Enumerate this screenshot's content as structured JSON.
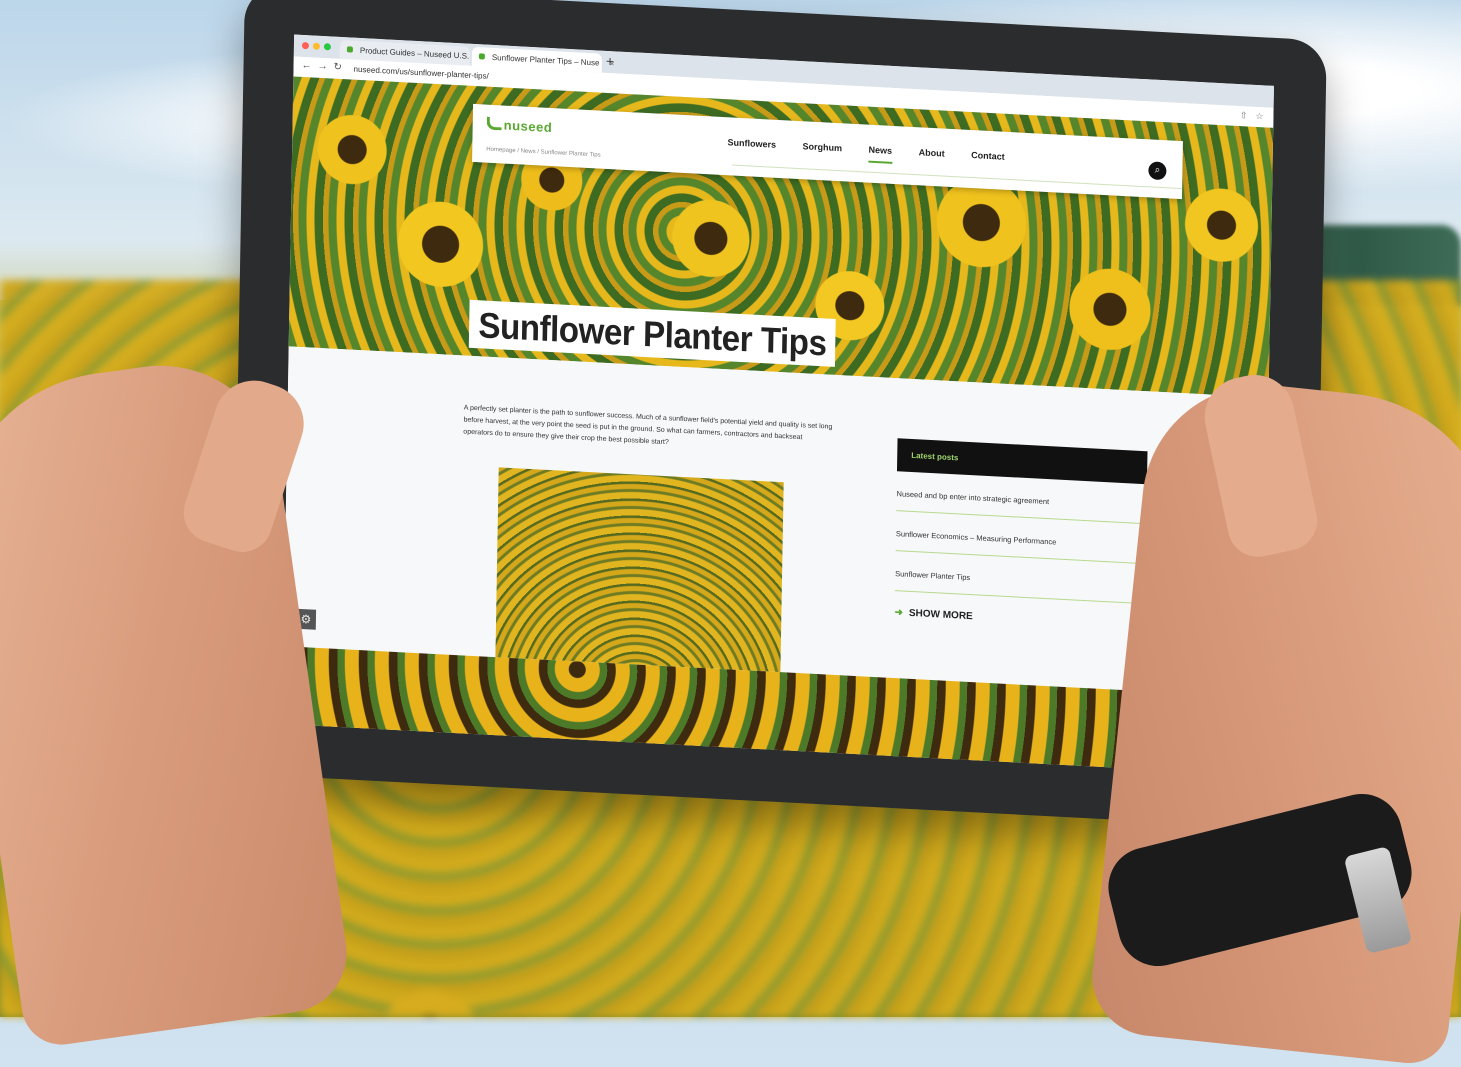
{
  "browser": {
    "tabs": [
      {
        "label": "Product Guides – Nuseed U.S."
      },
      {
        "label": "Sunflower Planter Tips – Nuse"
      }
    ],
    "new_tab_symbol": "+",
    "url": "nuseed.com/us/sunflower-planter-tips/"
  },
  "site": {
    "logo_text": "nuseed",
    "nav": [
      "Sunflowers",
      "Sorghum",
      "News",
      "About",
      "Contact"
    ],
    "active_nav": "News",
    "breadcrumb": "Homepage  /  News  /  Sunflower Planter Tips"
  },
  "article": {
    "title": "Sunflower Planter Tips",
    "intro": "A perfectly set planter is the path to sunflower success. Much of a sunflower field's potential yield and quality is set long before harvest, at the very point the seed is put in the ground. So what can farmers, contractors and backseat operators do to ensure they give their crop the best possible start?"
  },
  "sidebar": {
    "header": "Latest posts",
    "posts": [
      "Nuseed and bp enter into strategic agreement",
      "Sunflower Economics – Measuring Performance",
      "Sunflower Planter Tips"
    ],
    "show_more": "SHOW MORE"
  },
  "icons": {
    "search": "search-icon",
    "settings": "gear-icon",
    "back": "arrow-left-icon",
    "forward": "arrow-right-icon",
    "reload": "reload-icon"
  },
  "colors": {
    "brand_green": "#5aa832",
    "sidebar_header_bg": "#111111"
  }
}
